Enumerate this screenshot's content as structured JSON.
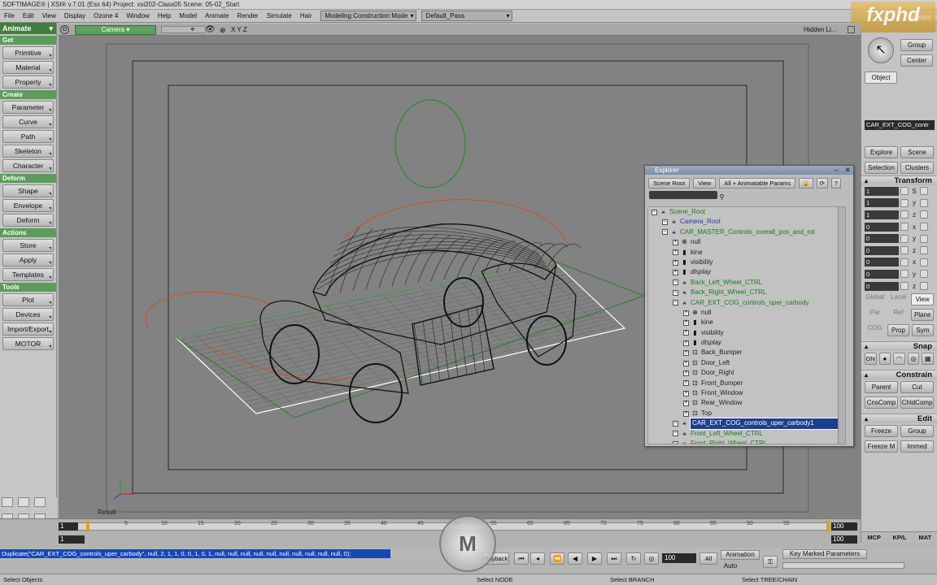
{
  "titlebar": {
    "text": "SOFTIMAGE® | XSI® v.7.01 (Ess 64) Project: xsi202-Class05    Scene: 05-02_Start"
  },
  "menubar": {
    "items": [
      "File",
      "Edit",
      "View",
      "Display",
      "Ozone 4",
      "Window",
      "Help",
      "Model",
      "Animate",
      "Render",
      "Simulate",
      "Hair"
    ],
    "construction_mode": "Modeling Construction Mode",
    "pass": "Default_Pass"
  },
  "logo": {
    "text": "fxphd",
    "sub": "Select"
  },
  "leftpanel": {
    "mode": "Animate",
    "sections": [
      {
        "header": "Get",
        "buttons": [
          "Primitive",
          "Material",
          "Property"
        ]
      },
      {
        "header": "Create",
        "buttons": [
          "Parameter",
          "Curve",
          "Path",
          "Skeleton",
          "Character"
        ]
      },
      {
        "header": "Deform",
        "buttons": [
          "Shape",
          "Envelope",
          "Deform"
        ]
      },
      {
        "header": "Actions",
        "buttons": [
          "Store",
          "Apply",
          "Templates"
        ]
      },
      {
        "header": "Tools",
        "buttons": [
          "Plot",
          "Devices",
          "Import/Export",
          "MOTOR"
        ]
      }
    ]
  },
  "viewport": {
    "camera": "Camera",
    "axes": "X Y Z",
    "hidden": "Hidden Li...",
    "result_label": "Result"
  },
  "explorer": {
    "title": "Explorer",
    "scope": "Scene Root",
    "view": "View",
    "filter": "All + Animatable Params",
    "tree": [
      {
        "label": "Scene_Root",
        "depth": 0,
        "icon": "scene",
        "color": "green"
      },
      {
        "label": "Camera_Root",
        "depth": 1,
        "icon": "model",
        "color": "blue"
      },
      {
        "label": "CAR_MASTER_Controls_overall_pos_and_rot",
        "depth": 1,
        "icon": "model",
        "color": "green"
      },
      {
        "label": "null",
        "depth": 2,
        "icon": "null",
        "color": "dark"
      },
      {
        "label": "kine",
        "depth": 2,
        "icon": "prop",
        "color": "dark"
      },
      {
        "label": "visibility",
        "depth": 2,
        "icon": "prop",
        "color": "dark"
      },
      {
        "label": "display",
        "depth": 2,
        "icon": "prop",
        "color": "dark",
        "italic": true
      },
      {
        "label": "Back_Left_Wheel_CTRL",
        "depth": 2,
        "icon": "model",
        "color": "green"
      },
      {
        "label": "Back_Right_Wheel_CTRL",
        "depth": 2,
        "icon": "model",
        "color": "green"
      },
      {
        "label": "CAR_EXT_COG_controls_uper_carbody",
        "depth": 2,
        "icon": "model",
        "color": "green"
      },
      {
        "label": "null",
        "depth": 3,
        "icon": "null",
        "color": "dark"
      },
      {
        "label": "kine",
        "depth": 3,
        "icon": "prop",
        "color": "dark"
      },
      {
        "label": "visibility",
        "depth": 3,
        "icon": "prop",
        "color": "dark"
      },
      {
        "label": "display",
        "depth": 3,
        "icon": "prop",
        "color": "dark",
        "italic": true
      },
      {
        "label": "Back_Bumper",
        "depth": 3,
        "icon": "mesh",
        "color": "dark"
      },
      {
        "label": "Door_Left",
        "depth": 3,
        "icon": "mesh",
        "color": "dark"
      },
      {
        "label": "Door_Right",
        "depth": 3,
        "icon": "mesh",
        "color": "dark"
      },
      {
        "label": "Front_Bumper",
        "depth": 3,
        "icon": "mesh",
        "color": "dark"
      },
      {
        "label": "Front_Window",
        "depth": 3,
        "icon": "mesh",
        "color": "dark"
      },
      {
        "label": "Rear_Window",
        "depth": 3,
        "icon": "mesh",
        "color": "dark"
      },
      {
        "label": "Top",
        "depth": 3,
        "icon": "mesh",
        "color": "dark"
      },
      {
        "label": "CAR_EXT_COG_controls_uper_carbody1",
        "depth": 2,
        "icon": "model",
        "color": "green",
        "selected": true
      },
      {
        "label": "Front_Left_Wheel_CTRL",
        "depth": 2,
        "icon": "model",
        "color": "green"
      },
      {
        "label": "Front_Right_Wheel_CTRL",
        "depth": 2,
        "icon": "model",
        "color": "green"
      }
    ]
  },
  "rightpanel": {
    "top_buttons": [
      "Group",
      "Center",
      "Object"
    ],
    "object_name": "CAR_EXT_COG_contr",
    "explore_row": [
      "Explore",
      "Scene"
    ],
    "selection_row": [
      "Selection",
      "Clusters"
    ],
    "transform": {
      "header": "Transform",
      "scale": [
        {
          "v": "1",
          "a": "S"
        },
        {
          "v": "1",
          "a": "y"
        },
        {
          "v": "1",
          "a": "z"
        }
      ],
      "rotate": [
        {
          "v": "0",
          "a": "x"
        },
        {
          "v": "0",
          "a": "y"
        },
        {
          "v": "0",
          "a": "z"
        }
      ],
      "translate": [
        {
          "v": "0",
          "a": "x"
        },
        {
          "v": "0",
          "a": "y"
        },
        {
          "v": "0",
          "a": "z"
        }
      ],
      "space": [
        "Global",
        "Local",
        "View"
      ],
      "ref": [
        "Par",
        "Ref",
        "Plane"
      ],
      "cog": [
        "COG",
        "Prop",
        "Sym"
      ]
    },
    "snap": {
      "header": "Snap",
      "on": "ON"
    },
    "constrain": {
      "header": "Constrain",
      "row1": [
        "Parent",
        "Cut"
      ],
      "row2": [
        "CnsComp",
        "ChldComp"
      ]
    },
    "edit": {
      "header": "Edit",
      "row1": [
        "Freeze",
        "Group"
      ],
      "row2": [
        "Freeze M",
        "Immed"
      ]
    },
    "tabs": [
      "MCP",
      "KP/L",
      "MAT"
    ]
  },
  "timeline": {
    "start": "1",
    "end": "100",
    "end2": "100",
    "ticks": [
      "5",
      "10",
      "15",
      "20",
      "25",
      "30",
      "35",
      "40",
      "45",
      "50",
      "55",
      "60",
      "65",
      "70",
      "75",
      "80",
      "85",
      "90",
      "95"
    ],
    "current": "1",
    "frame_field": "100",
    "all": "All",
    "playback": "Playback"
  },
  "bottom": {
    "command": "Duplicate(\"CAR_EXT_COG_controls_uper_carbody\", null, 2, 1, 1, 0, 0, 1, 0, 1, null, null, null, null, null, null, null, null, null, null, 0);",
    "animation": "Animation",
    "auto": "Auto",
    "key_marked": "Key Marked Parameters",
    "status_left": "Select Objects",
    "status_m1": "Select NODE",
    "status_m2": "Select BRANCH",
    "status_r": "Select TREE/CHAIN"
  }
}
